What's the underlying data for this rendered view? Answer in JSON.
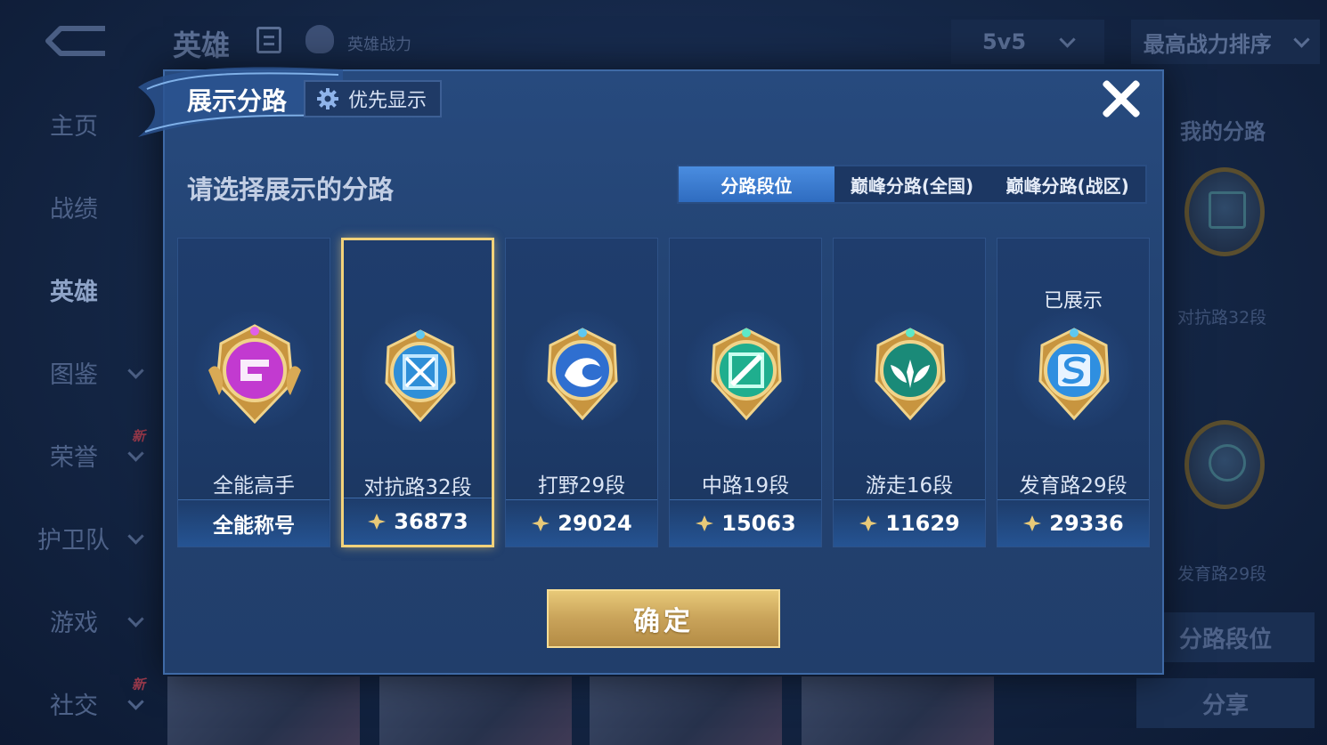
{
  "background": {
    "title": "英雄",
    "hero_power_label": "英雄战力",
    "mode_select": "5v5",
    "sort_select": "最高战力排序",
    "nav": [
      {
        "label": "主页",
        "active": false,
        "chevron": false,
        "new": false
      },
      {
        "label": "战绩",
        "active": false,
        "chevron": false,
        "new": false
      },
      {
        "label": "英雄",
        "active": true,
        "chevron": false,
        "new": false
      },
      {
        "label": "图鉴",
        "active": false,
        "chevron": true,
        "new": false
      },
      {
        "label": "荣誉",
        "active": false,
        "chevron": true,
        "new": true
      },
      {
        "label": "护卫队",
        "active": false,
        "chevron": true,
        "new": false
      },
      {
        "label": "游戏",
        "active": false,
        "chevron": true,
        "new": false
      },
      {
        "label": "社交",
        "active": false,
        "chevron": true,
        "new": true
      }
    ],
    "new_badge": "新",
    "right_panel": {
      "title": "我的分路",
      "entries": [
        "对抗路32段",
        "发育路29段"
      ],
      "lane_rank_button": "分路段位",
      "share_button": "分享"
    }
  },
  "modal": {
    "title": "展示分路",
    "priority_button": "优先显示",
    "subtitle": "请选择展示的分路",
    "tabs": [
      {
        "label": "分路段位",
        "active": true
      },
      {
        "label": "巅峰分路(全国)",
        "active": false
      },
      {
        "label": "巅峰分路(战区)",
        "active": false
      }
    ],
    "cards": [
      {
        "name": "全能高手",
        "footer": "全能称号",
        "has_score": false,
        "selected": false,
        "shown": "",
        "icon": "all-round-badge-icon",
        "color": "#c23ad0"
      },
      {
        "name": "对抗路32段",
        "footer": "36873",
        "has_score": true,
        "selected": true,
        "shown": "",
        "icon": "clash-lane-badge-icon",
        "color": "#2f8fd8"
      },
      {
        "name": "打野29段",
        "footer": "29024",
        "has_score": true,
        "selected": false,
        "shown": "",
        "icon": "jungle-badge-icon",
        "color": "#2f6fd0"
      },
      {
        "name": "中路19段",
        "footer": "15063",
        "has_score": true,
        "selected": false,
        "shown": "",
        "icon": "mid-lane-badge-icon",
        "color": "#1fae8e"
      },
      {
        "name": "游走16段",
        "footer": "11629",
        "has_score": true,
        "selected": false,
        "shown": "",
        "icon": "roam-badge-icon",
        "color": "#1a8a78"
      },
      {
        "name": "发育路29段",
        "footer": "29336",
        "has_score": true,
        "selected": false,
        "shown": "已展示",
        "icon": "farm-lane-badge-icon",
        "color": "#2f8fe0"
      }
    ],
    "confirm_button": "确定"
  },
  "colors": {
    "accent_gold": "#f2d27a",
    "tab_active": "#3f7fd4",
    "modal_bg": "#244676"
  }
}
